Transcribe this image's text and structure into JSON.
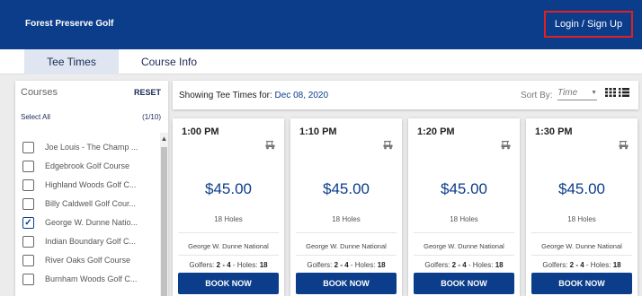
{
  "header": {
    "brand": "Forest Preserve Golf",
    "login_label": "Login / Sign Up"
  },
  "tabs": {
    "tee_times": "Tee Times",
    "course_info": "Course Info"
  },
  "sidebar": {
    "title": "Courses",
    "reset": "RESET",
    "select_all": "Select All",
    "count": "(1/10)",
    "courses": [
      {
        "name": "Joe Louis - The Champ ...",
        "checked": false
      },
      {
        "name": "Edgebrook Golf Course",
        "checked": false
      },
      {
        "name": "Highland Woods Golf C...",
        "checked": false
      },
      {
        "name": "Billy Caldwell Golf Cour...",
        "checked": false
      },
      {
        "name": "George W. Dunne Natio...",
        "checked": true
      },
      {
        "name": "Indian Boundary Golf C...",
        "checked": false
      },
      {
        "name": "River Oaks Golf Course",
        "checked": false
      },
      {
        "name": "Burnham Woods Golf C...",
        "checked": false
      }
    ]
  },
  "main": {
    "showing_prefix": "Showing Tee Times for: ",
    "showing_date": "Dec 08, 2020",
    "sort_label": "Sort By:",
    "sort_value": "Time",
    "view_icons": [
      "grid-view-icon",
      "list-view-icon"
    ]
  },
  "tee_times": [
    {
      "time": "1:00 PM",
      "price": "$45.00",
      "holes": "18 Holes",
      "course": "George W. Dunne National",
      "golfers_label": "Golfers:",
      "golfers_range": "2 - 4",
      "holes_label": "- Holes:",
      "holes_count": "18",
      "book": "BOOK NOW"
    },
    {
      "time": "1:10 PM",
      "price": "$45.00",
      "holes": "18 Holes",
      "course": "George W. Dunne National",
      "golfers_label": "Golfers:",
      "golfers_range": "2 - 4",
      "holes_label": "- Holes:",
      "holes_count": "18",
      "book": "BOOK NOW"
    },
    {
      "time": "1:20 PM",
      "price": "$45.00",
      "holes": "18 Holes",
      "course": "George W. Dunne National",
      "golfers_label": "Golfers:",
      "golfers_range": "2 - 4",
      "holes_label": "- Holes:",
      "holes_count": "18",
      "book": "BOOK NOW"
    },
    {
      "time": "1:30 PM",
      "price": "$45.00",
      "holes": "18 Holes",
      "course": "George W. Dunne National",
      "golfers_label": "Golfers:",
      "golfers_range": "2 - 4",
      "holes_label": "- Holes:",
      "holes_count": "18",
      "book": "BOOK NOW"
    }
  ],
  "colors": {
    "brand_blue": "#0b3d8a",
    "login_border": "#e32020",
    "active_tab": "#dfe6f1"
  }
}
